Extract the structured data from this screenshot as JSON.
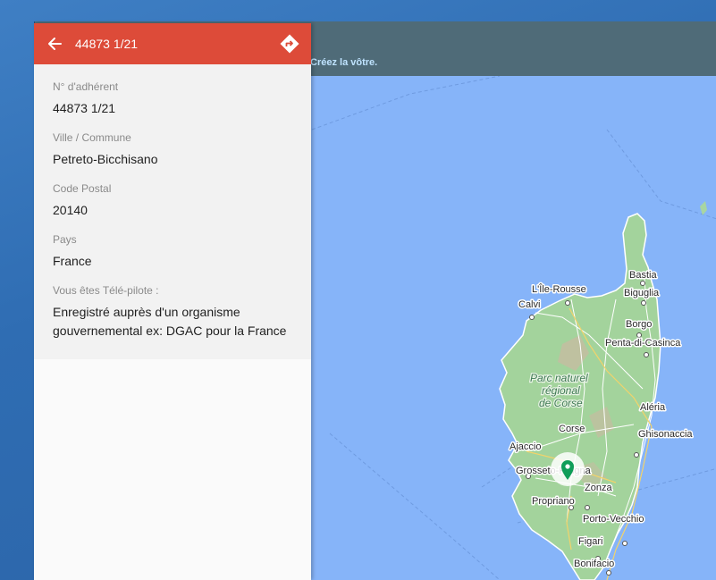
{
  "map": {
    "create_link": "Créez la vôtre.",
    "marker_color": "#0f9d58",
    "labels": {
      "bastia": "Bastia",
      "biguglia": "Biguglia",
      "ile_rousse": "L'Île-Rousse",
      "calvi": "Calvi",
      "borgo": "Borgo",
      "penta": "Penta-di-Casinca",
      "park1": "Parc naturel",
      "park2": "régional",
      "park3": "de Corse",
      "aleria": "Aléria",
      "corse": "Corse",
      "ghisonaccia": "Ghisonaccia",
      "ajaccio": "Ajaccio",
      "grosseto": "Grosseto-Prugna",
      "zonza": "Zonza",
      "propriano": "Propriano",
      "porto_vecchio": "Porto-Vecchio",
      "figari": "Figari",
      "bonifacio": "Bonifacio"
    }
  },
  "panel": {
    "title": "44873 1/21",
    "accent_color": "#dd4b39",
    "fields": [
      {
        "label": "N° d'adhérent",
        "value": "44873 1/21"
      },
      {
        "label": "Ville / Commune",
        "value": "Petreto-Bicchisano"
      },
      {
        "label": "Code Postal",
        "value": "20140"
      },
      {
        "label": "Pays",
        "value": "France"
      },
      {
        "label": "Vous êtes Télé-pilote :",
        "value": "Enregistré auprès d'un organisme gouvernemental ex: DGAC pour la France"
      }
    ]
  }
}
